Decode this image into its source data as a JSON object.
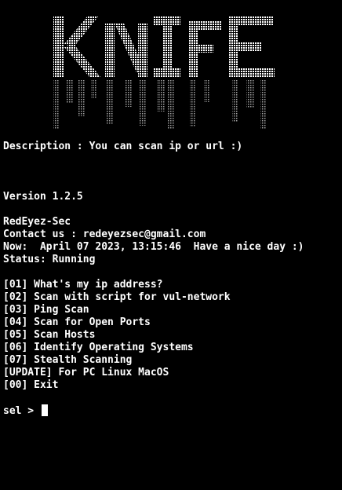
{
  "banner": {
    "text": "KNIFE",
    "color": "#ffffff"
  },
  "info": {
    "description": "Description : You can scan ip or url :)",
    "version": "Version 1.2.5",
    "author": "RedEyez-Sec",
    "contact": "Contact us : redeyezsec@gmail.com",
    "now": "Now:  April 07 2023, 13:15:46  Have a nice day :)",
    "status": "Status: Running"
  },
  "menu": {
    "items": [
      {
        "label": "[01] What's my ip address?"
      },
      {
        "label": "[02] Scan with script for vul-network"
      },
      {
        "label": "[03] Ping Scan"
      },
      {
        "label": "[04] Scan for Open Ports"
      },
      {
        "label": "[05] Scan Hosts"
      },
      {
        "label": "[06] Identify Operating Systems"
      },
      {
        "label": "[07] Stealth Scanning"
      },
      {
        "label": "[UPDATE] For PC Linux MacOS"
      },
      {
        "label": "[00] Exit"
      }
    ]
  },
  "prompt": {
    "text": "sel > "
  },
  "colors": {
    "background": "#000000",
    "foreground": "#ffffff"
  }
}
